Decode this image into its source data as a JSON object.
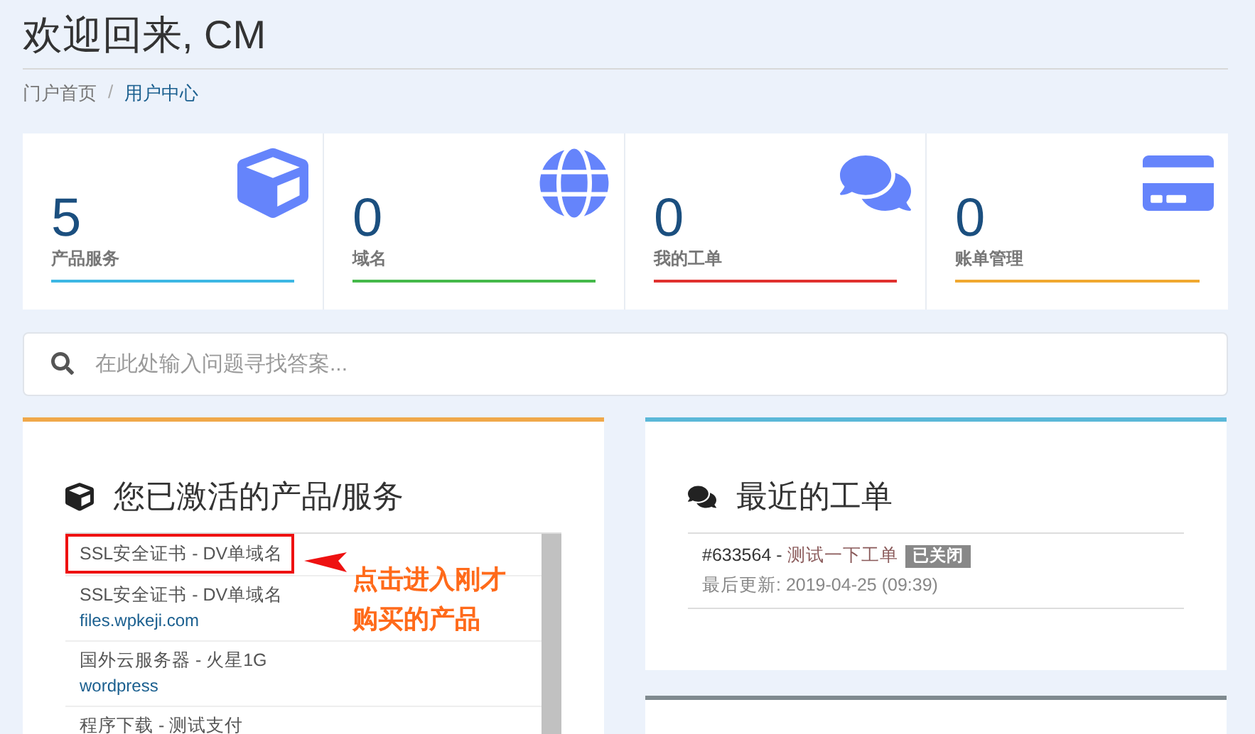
{
  "page": {
    "title": "欢迎回来, CM"
  },
  "breadcrumb_separator": "/",
  "breadcrumb": [
    {
      "label": "门户首页",
      "selected": false
    },
    {
      "label": "用户中心",
      "selected": true
    }
  ],
  "stats": [
    {
      "kind": "cube",
      "value": "5",
      "label": "产品服务",
      "color": "#3db7e4"
    },
    {
      "kind": "globe",
      "value": "0",
      "label": "域名",
      "color": "#45b94a"
    },
    {
      "kind": "comments",
      "value": "0",
      "label": "我的工单",
      "color": "#e0312f"
    },
    {
      "kind": "card",
      "value": "0",
      "label": "账单管理",
      "color": "#f0a830"
    }
  ],
  "search": {
    "placeholder": "在此处输入问题寻找答案..."
  },
  "products_panel": {
    "title": "您已激活的产品/服务",
    "items": [
      {
        "name": "SSL安全证书 - DV单域名",
        "highlighted": true
      },
      {
        "name": "SSL安全证书 - DV单域名",
        "domain": "files.wpkeji.com",
        "highlighted": false
      },
      {
        "name": "国外云服务器 - 火星1G",
        "domain": "wordpress",
        "highlighted": false
      },
      {
        "name": "程序下载 - 测试支付",
        "highlighted": false
      }
    ],
    "annotation": {
      "lines": [
        "点击进入刚才",
        "购买的产品"
      ]
    }
  },
  "tickets_panel": {
    "title": "最近的工单",
    "tickets": [
      {
        "number": "#633564",
        "separator": "-",
        "subject": "测试一下工单",
        "status": "已关闭",
        "updated": "最后更新: 2019-04-25 (09:39)"
      }
    ]
  }
}
